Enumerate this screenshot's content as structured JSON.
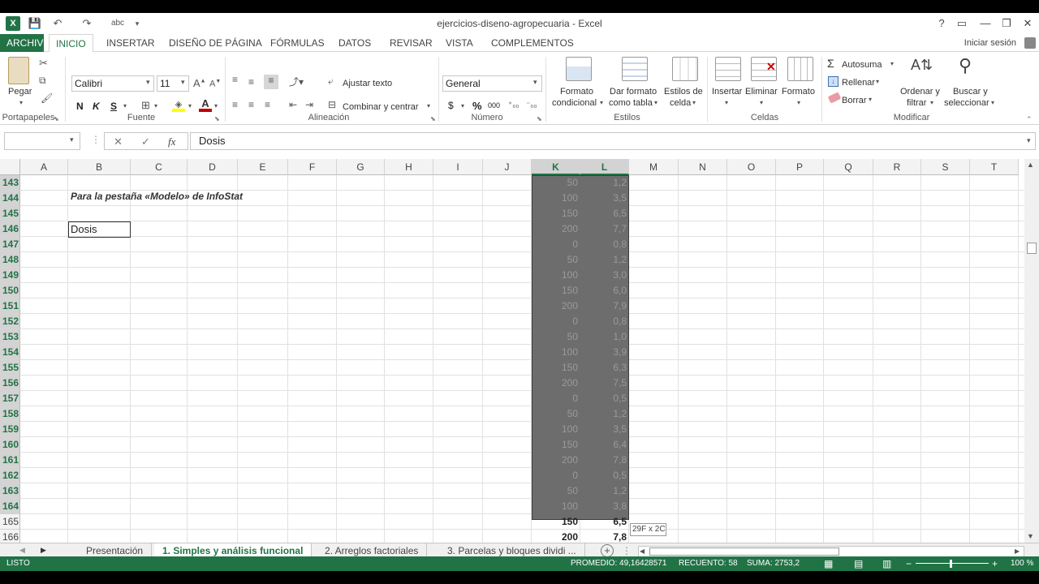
{
  "window": {
    "title": "ejercicios-diseno-agropecuaria - Excel",
    "signin": "Iniciar sesión"
  },
  "tabs": [
    "ARCHIVO",
    "INICIO",
    "INSERTAR",
    "DISEÑO DE PÁGINA",
    "FÓRMULAS",
    "DATOS",
    "REVISAR",
    "VISTA",
    "COMPLEMENTOS"
  ],
  "ribbon": {
    "clipboard": {
      "paste": "Pegar",
      "label": "Portapapeles"
    },
    "font": {
      "name": "Calibri",
      "size": "11",
      "label": "Fuente",
      "bold": "N",
      "italic": "K",
      "underline": "S"
    },
    "alignment": {
      "wrap": "Ajustar texto",
      "merge": "Combinar y centrar",
      "label": "Alineación"
    },
    "number": {
      "format": "General",
      "label": "Número",
      "currency": "$",
      "percent": "%",
      "thousands": "000"
    },
    "styles": {
      "cond1": "Formato",
      "cond2": "condicional",
      "table1": "Dar formato",
      "table2": "como tabla",
      "cell1": "Estilos de",
      "cell2": "celda",
      "label": "Estilos"
    },
    "cells": {
      "insert": "Insertar",
      "delete": "Eliminar",
      "format": "Formato",
      "label": "Celdas"
    },
    "editing": {
      "autosum": "Autosuma",
      "fill": "Rellenar",
      "clear": "Borrar",
      "sort1": "Ordenar y",
      "sort2": "filtrar",
      "find1": "Buscar y",
      "find2": "seleccionar",
      "label": "Modificar"
    }
  },
  "formula_bar": {
    "name_box": "",
    "cancel": "✕",
    "enter": "✓",
    "fx": "fx",
    "value": "Dosis"
  },
  "grid": {
    "columns": [
      "A",
      "B",
      "C",
      "D",
      "E",
      "F",
      "G",
      "H",
      "I",
      "J",
      "K",
      "L",
      "M",
      "N",
      "O",
      "P",
      "Q",
      "R",
      "S",
      "T"
    ],
    "rows": [
      "143",
      "144",
      "145",
      "146",
      "147",
      "148",
      "149",
      "150",
      "151",
      "152",
      "153",
      "154",
      "155",
      "156",
      "157",
      "158",
      "159",
      "160",
      "161",
      "162",
      "163",
      "164",
      "165",
      "166"
    ],
    "note": "Para la pestaña «Modelo» de InfoStat",
    "dosis_cell": "Dosis",
    "k_values": [
      "50",
      "100",
      "150",
      "200",
      "0",
      "50",
      "100",
      "150",
      "200",
      "0",
      "50",
      "100",
      "150",
      "200",
      "0",
      "50",
      "100",
      "150",
      "200",
      "0",
      "50",
      "100",
      "150",
      "200"
    ],
    "l_values": [
      "1,2",
      "3,5",
      "6,5",
      "7,7",
      "0,8",
      "1,2",
      "3,0",
      "6,0",
      "7,9",
      "0,8",
      "1,0",
      "3,9",
      "6,3",
      "7,5",
      "0,5",
      "1,2",
      "3,5",
      "6,4",
      "7,8",
      "0,5",
      "1,2",
      "3,8",
      "6,5",
      "7,8"
    ],
    "size_tip": "29F x 2C"
  },
  "sheets": [
    "Presentación",
    "1. Simples y análisis funcional",
    "2. Arreglos factoriales",
    "3. Parcelas y bloques dividi ..."
  ],
  "status": {
    "ready": "LISTO",
    "average": "PROMEDIO: 49,16428571",
    "count": "RECUENTO: 58",
    "sum": "SUMA: 2753,2",
    "zoom": "100 %"
  },
  "colors": {
    "accent": "#217346",
    "selection": "#6d6d6d"
  }
}
